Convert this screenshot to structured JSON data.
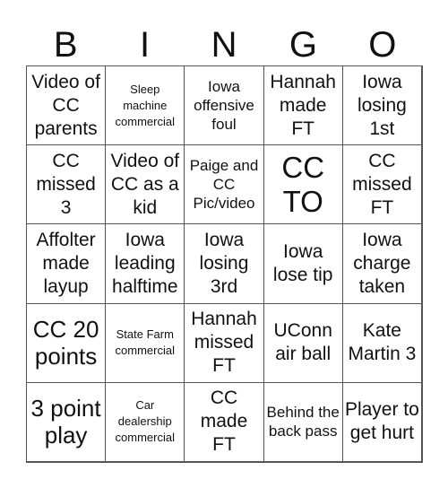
{
  "header": {
    "letters": [
      "B",
      "I",
      "N",
      "G",
      "O"
    ]
  },
  "cells": [
    [
      "Video of CC parents",
      "Sleep machine commercial",
      "Iowa offensive foul",
      "Hannah made FT",
      "Iowa losing 1st"
    ],
    [
      "CC missed 3",
      "Video of CC as a kid",
      "Paige and CC Pic/video",
      "CC TO",
      "CC missed FT"
    ],
    [
      "Affolter made layup",
      "Iowa leading halftime",
      "Iowa losing 3rd",
      "Iowa lose tip",
      "Iowa charge taken"
    ],
    [
      "CC 20 points",
      "State Farm commercial",
      "Hannah missed FT",
      "UConn air ball",
      "Kate Martin 3"
    ],
    [
      "3 point play",
      "Car dealership commercial",
      "CC made FT",
      "Behind the back pass",
      "Player to get hurt"
    ]
  ]
}
